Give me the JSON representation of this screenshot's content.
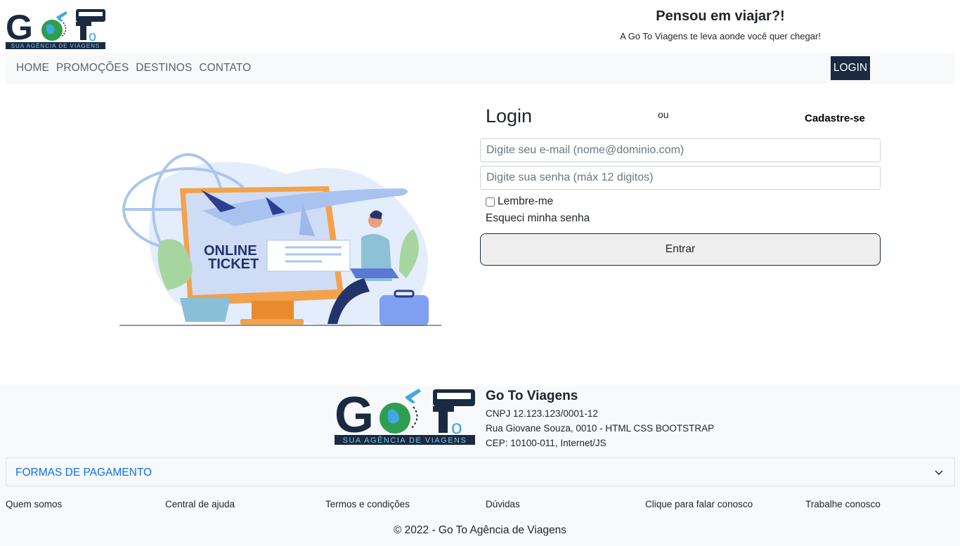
{
  "brand": {
    "logo_text": "Go To",
    "logo_subtitle": "SUA AGÊNCIA DE VIAGENS"
  },
  "header": {
    "title": "Pensou em viajar?!",
    "subtitle": "A Go To Viagens te leva aonde você quer chegar!"
  },
  "nav": {
    "items": [
      "HOME",
      "PROMOÇÕES",
      "DESTINOS",
      "CONTATO"
    ],
    "login_label": "LOGIN"
  },
  "illustration": {
    "text_line1": "ONLINE",
    "text_line2": "TICKET"
  },
  "login": {
    "title": "Login",
    "or_label": "ou",
    "signup_label": "Cadastre-se",
    "email_placeholder": "Digite seu e-mail (nome@dominio.com)",
    "password_placeholder": "Digite sua senha (máx 12 digitos)",
    "remember_label": "Lembre-me",
    "forgot_label": "Esqueci minha senha",
    "submit_label": "Entrar"
  },
  "footer": {
    "company_name": "Go To Viagens",
    "cnpj": "CNPJ 12.123.123/0001-12",
    "address": "Rua Giovane Souza, 0010 - HTML CSS BOOTSTRAP",
    "cep": "CEP: 10100-011, Internet/JS",
    "payment_label": "FORMAS DE PAGAMENTO",
    "links": [
      "Quem somos",
      "Central de ajuda",
      "Termos e condições",
      "Dúvidas",
      "Clique para falar conosco",
      "Trabalhe conosco"
    ],
    "copyright": "© 2022 - Go To Agência de Viagens"
  },
  "colors": {
    "navy": "#1a2a40",
    "link_blue": "#0d6efd",
    "green": "#2e9e4f",
    "sky": "#3fa9e0"
  }
}
